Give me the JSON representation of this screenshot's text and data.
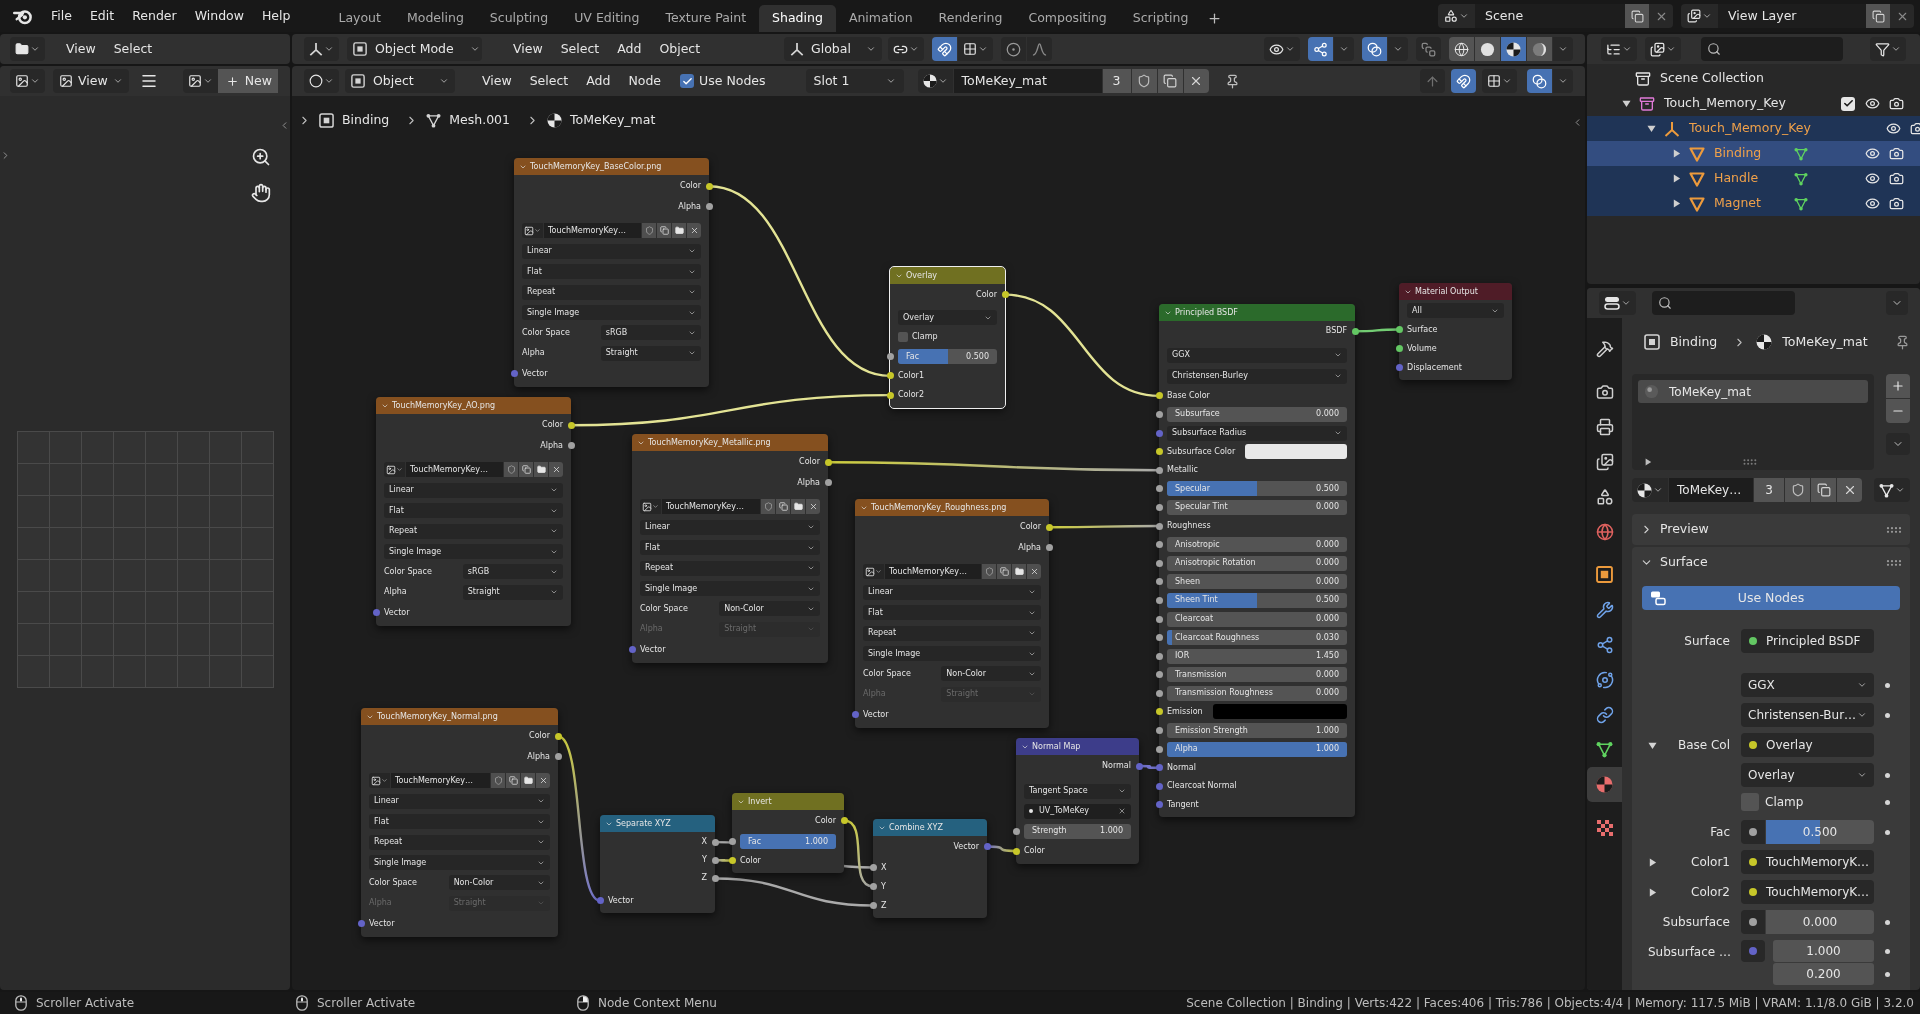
{
  "top_bar": {
    "menus": [
      "File",
      "Edit",
      "Render",
      "Window",
      "Help"
    ],
    "workspaces": [
      {
        "label": "Layout",
        "selected": false
      },
      {
        "label": "Modeling",
        "selected": false
      },
      {
        "label": "Sculpting",
        "selected": false
      },
      {
        "label": "UV Editing",
        "selected": false
      },
      {
        "label": "Texture Paint",
        "selected": false
      },
      {
        "label": "Shading",
        "selected": true
      },
      {
        "label": "Animation",
        "selected": false
      },
      {
        "label": "Rendering",
        "selected": false
      },
      {
        "label": "Compositing",
        "selected": false
      },
      {
        "label": "Scripting",
        "selected": false
      }
    ],
    "scene": "Scene",
    "view_layer": "View Layer"
  },
  "file_browser": {
    "menus": [
      "View",
      "Select"
    ]
  },
  "image_editor": {
    "view": "View",
    "new_button": "New"
  },
  "viewport_header": {
    "mode": "Object Mode",
    "menus": [
      "View",
      "Select",
      "Add",
      "Object"
    ],
    "orientation": "Global",
    "snap": true,
    "proportional_editing": false,
    "gizmos": true,
    "overlays": true,
    "xray": false,
    "shading": [
      {
        "kind": "wireframe",
        "selected": false
      },
      {
        "kind": "solid",
        "selected": false
      },
      {
        "kind": "material",
        "selected": true
      },
      {
        "kind": "rendered",
        "selected": false
      }
    ]
  },
  "node_header": {
    "type": "Object",
    "menus": [
      "View",
      "Select",
      "Add",
      "Node"
    ],
    "use_nodes": {
      "label": "Use Nodes",
      "checked": true
    },
    "slot": "Slot 1",
    "material": "ToMeKey_mat",
    "users": "3",
    "snap": true,
    "overlays": true
  },
  "breadcrumb": [
    {
      "kind": "object",
      "label": "Binding"
    },
    {
      "kind": "mesh",
      "label": "Mesh.001"
    },
    {
      "kind": "material",
      "label": "ToMeKey_mat"
    }
  ],
  "nodes": [
    {
      "title": "TouchMemoryKey_BaseColor.png",
      "color": "#85501f",
      "selected": false,
      "rows": [
        {
          "kind": "output",
          "label": "Color",
          "color": "#c7c729"
        },
        {
          "kind": "output",
          "label": "Alpha",
          "color": "#a1a1a1"
        },
        {
          "kind": "image",
          "value": "TouchMemoryKey…"
        },
        {
          "kind": "select",
          "value": "Linear"
        },
        {
          "kind": "select",
          "value": "Flat"
        },
        {
          "kind": "select",
          "value": "Repeat"
        },
        {
          "kind": "select",
          "value": "Single Image"
        },
        {
          "kind": "prop_select",
          "label": "Color Space",
          "value": "sRGB",
          "disabled": false
        },
        {
          "kind": "prop_select",
          "label": "Alpha",
          "value": "Straight",
          "disabled": false
        },
        {
          "kind": "input",
          "label": "Vector",
          "color": "#6363c7"
        }
      ]
    },
    {
      "title": "Overlay",
      "color": "#707021",
      "selected": true,
      "rows": [
        {
          "kind": "output",
          "label": "Color",
          "color": "#c7c729"
        },
        {
          "kind": "select",
          "value": "Overlay"
        },
        {
          "kind": "checkbox",
          "label": "Clamp",
          "checked": false
        },
        {
          "kind": "slider",
          "label": "Fac",
          "value": "0.500",
          "level": 0.5,
          "color": "#a1a1a1"
        },
        {
          "kind": "input",
          "label": "Color1",
          "color": "#c7c729"
        },
        {
          "kind": "input",
          "label": "Color2",
          "color": "#c7c729"
        }
      ]
    },
    {
      "title": "Material Output",
      "color": "#4f1c27",
      "selected": false,
      "rows": [
        {
          "kind": "select",
          "value": "All"
        },
        {
          "kind": "input",
          "label": "Surface",
          "color": "#63c763"
        },
        {
          "kind": "input",
          "label": "Volume",
          "color": "#63c763"
        },
        {
          "kind": "input",
          "label": "Displacement",
          "color": "#6363c7"
        }
      ]
    },
    {
      "title": "Principled BSDF",
      "color": "#2b6a2b",
      "selected": false,
      "rows": [
        {
          "kind": "output",
          "label": "BSDF",
          "color": "#63c763"
        },
        {
          "kind": "select",
          "value": "GGX"
        },
        {
          "kind": "select",
          "value": "Christensen-Burley"
        },
        {
          "kind": "input",
          "label": "Base Color",
          "color": "#c7c729"
        },
        {
          "kind": "slider",
          "label": "Subsurface",
          "value": "0.000",
          "level": 0,
          "color": "#a1a1a1"
        },
        {
          "kind": "socket_select",
          "label": "Subsurface Radius",
          "color": "#6363c7"
        },
        {
          "kind": "color",
          "label": "Subsurface Color",
          "color": "#c7c729",
          "swatch": {
            "color": "#e8e8e8"
          }
        },
        {
          "kind": "input",
          "label": "Metallic",
          "color": "#a1a1a1"
        },
        {
          "kind": "slider",
          "label": "Specular",
          "value": "0.500",
          "level": 0.5,
          "color": "#a1a1a1"
        },
        {
          "kind": "slider",
          "label": "Specular Tint",
          "value": "0.000",
          "level": 0,
          "color": "#a1a1a1"
        },
        {
          "kind": "input",
          "label": "Roughness",
          "color": "#a1a1a1"
        },
        {
          "kind": "slider",
          "label": "Anisotropic",
          "value": "0.000",
          "level": 0,
          "color": "#a1a1a1"
        },
        {
          "kind": "slider",
          "label": "Anisotropic Rotation",
          "value": "0.000",
          "level": 0,
          "color": "#a1a1a1"
        },
        {
          "kind": "slider",
          "label": "Sheen",
          "value": "0.000",
          "level": 0,
          "color": "#a1a1a1"
        },
        {
          "kind": "slider",
          "label": "Sheen Tint",
          "value": "0.500",
          "level": 0.5,
          "color": "#a1a1a1"
        },
        {
          "kind": "slider",
          "label": "Clearcoat",
          "value": "0.000",
          "level": 0,
          "color": "#a1a1a1"
        },
        {
          "kind": "slider",
          "label": "Clearcoat Roughness",
          "value": "0.030",
          "level": 0.03,
          "color": "#a1a1a1"
        },
        {
          "kind": "slider",
          "label": "IOR",
          "value": "1.450",
          "color": "#a1a1a1"
        },
        {
          "kind": "slider",
          "label": "Transmission",
          "value": "0.000",
          "level": 0,
          "color": "#a1a1a1"
        },
        {
          "kind": "slider",
          "label": "Transmission Roughness",
          "value": "0.000",
          "level": 0,
          "color": "#a1a1a1"
        },
        {
          "kind": "color",
          "label": "Emission",
          "color": "#c7c729",
          "swatch": {
            "color": "#000000"
          }
        },
        {
          "kind": "slider",
          "label": "Emission Strength",
          "value": "1.000",
          "color": "#a1a1a1"
        },
        {
          "kind": "slider",
          "label": "Alpha",
          "value": "1.000",
          "level": 1,
          "color": "#a1a1a1"
        },
        {
          "kind": "input",
          "label": "Normal",
          "color": "#6363c7"
        },
        {
          "kind": "input",
          "label": "Clearcoat Normal",
          "color": "#6363c7"
        },
        {
          "kind": "input",
          "label": "Tangent",
          "color": "#6363c7"
        }
      ]
    },
    {
      "title": "TouchMemoryKey_AO.png",
      "color": "#85501f",
      "selected": false,
      "rows": [
        {
          "kind": "output",
          "label": "Color",
          "color": "#c7c729"
        },
        {
          "kind": "output",
          "label": "Alpha",
          "color": "#a1a1a1"
        },
        {
          "kind": "image",
          "value": "TouchMemoryKey…"
        },
        {
          "kind": "select",
          "value": "Linear"
        },
        {
          "kind": "select",
          "value": "Flat"
        },
        {
          "kind": "select",
          "value": "Repeat"
        },
        {
          "kind": "select",
          "value": "Single Image"
        },
        {
          "kind": "prop_select",
          "label": "Color Space",
          "value": "sRGB",
          "disabled": false
        },
        {
          "kind": "prop_select",
          "label": "Alpha",
          "value": "Straight",
          "disabled": false
        },
        {
          "kind": "input",
          "label": "Vector",
          "color": "#6363c7"
        }
      ]
    },
    {
      "title": "TouchMemoryKey_Metallic.png",
      "color": "#85501f",
      "selected": false,
      "rows": [
        {
          "kind": "output",
          "label": "Color",
          "color": "#c7c729"
        },
        {
          "kind": "output",
          "label": "Alpha",
          "color": "#a1a1a1"
        },
        {
          "kind": "image",
          "value": "TouchMemoryKey…"
        },
        {
          "kind": "select",
          "value": "Linear"
        },
        {
          "kind": "select",
          "value": "Flat"
        },
        {
          "kind": "select",
          "value": "Repeat"
        },
        {
          "kind": "select",
          "value": "Single Image"
        },
        {
          "kind": "prop_select",
          "label": "Color Space",
          "value": "Non-Color",
          "disabled": false
        },
        {
          "kind": "prop_select",
          "label": "Alpha",
          "value": "Straight",
          "disabled": true
        },
        {
          "kind": "input",
          "label": "Vector",
          "color": "#6363c7"
        }
      ]
    },
    {
      "title": "TouchMemoryKey_Roughness.png",
      "color": "#85501f",
      "selected": false,
      "rows": [
        {
          "kind": "output",
          "label": "Color",
          "color": "#c7c729"
        },
        {
          "kind": "output",
          "label": "Alpha",
          "color": "#a1a1a1"
        },
        {
          "kind": "image",
          "value": "TouchMemoryKey…"
        },
        {
          "kind": "select",
          "value": "Linear"
        },
        {
          "kind": "select",
          "value": "Flat"
        },
        {
          "kind": "select",
          "value": "Repeat"
        },
        {
          "kind": "select",
          "value": "Single Image"
        },
        {
          "kind": "prop_select",
          "label": "Color Space",
          "value": "Non-Color",
          "disabled": false
        },
        {
          "kind": "prop_select",
          "label": "Alpha",
          "value": "Straight",
          "disabled": true
        },
        {
          "kind": "input",
          "label": "Vector",
          "color": "#6363c7"
        }
      ]
    },
    {
      "title": "TouchMemoryKey_Normal.png",
      "color": "#85501f",
      "selected": false,
      "rows": [
        {
          "kind": "output",
          "label": "Color",
          "color": "#c7c729"
        },
        {
          "kind": "output",
          "label": "Alpha",
          "color": "#a1a1a1"
        },
        {
          "kind": "image",
          "value": "TouchMemoryKey…"
        },
        {
          "kind": "select",
          "value": "Linear"
        },
        {
          "kind": "select",
          "value": "Flat"
        },
        {
          "kind": "select",
          "value": "Repeat"
        },
        {
          "kind": "select",
          "value": "Single Image"
        },
        {
          "kind": "prop_select",
          "label": "Color Space",
          "value": "Non-Color",
          "disabled": false
        },
        {
          "kind": "prop_select",
          "label": "Alpha",
          "value": "Straight",
          "disabled": true
        },
        {
          "kind": "input",
          "label": "Vector",
          "color": "#6363c7"
        }
      ]
    },
    {
      "title": "Normal Map",
      "color": "#3d3d8a",
      "selected": false,
      "rows": [
        {
          "kind": "output",
          "label": "Normal",
          "color": "#6363c7"
        },
        {
          "kind": "select",
          "value": "Tangent Space"
        },
        {
          "kind": "uv_field",
          "value": "UV_ToMeKey"
        },
        {
          "kind": "slider",
          "label": "Strength",
          "value": "1.000",
          "color": "#a1a1a1"
        },
        {
          "kind": "input",
          "label": "Color",
          "color": "#c7c729"
        }
      ]
    },
    {
      "title": "Invert",
      "color": "#707021",
      "selected": false,
      "rows": [
        {
          "kind": "output",
          "label": "Color",
          "color": "#c7c729"
        },
        {
          "kind": "slider",
          "label": "Fac",
          "value": "1.000",
          "level": 1,
          "color": "#a1a1a1"
        },
        {
          "kind": "input",
          "label": "Color",
          "color": "#c7c729"
        }
      ]
    },
    {
      "title": "Separate XYZ",
      "color": "#25617f",
      "selected": false,
      "rows": [
        {
          "kind": "output",
          "label": "X",
          "color": "#a1a1a1"
        },
        {
          "kind": "output",
          "label": "Y",
          "color": "#a1a1a1"
        },
        {
          "kind": "output",
          "label": "Z",
          "color": "#a1a1a1"
        },
        {
          "kind": "input",
          "label": "Vector",
          "color": "#6363c7"
        }
      ]
    },
    {
      "title": "Combine XYZ",
      "color": "#25617f",
      "selected": false,
      "rows": [
        {
          "kind": "output",
          "label": "Vector",
          "color": "#6363c7"
        },
        {
          "kind": "input",
          "label": "X",
          "color": "#a1a1a1"
        },
        {
          "kind": "input",
          "label": "Y",
          "color": "#a1a1a1"
        },
        {
          "kind": "input",
          "label": "Z",
          "color": "#a1a1a1"
        }
      ]
    }
  ],
  "outliner": {
    "items": [
      {
        "kind": "scene_collection",
        "label": "Scene Collection",
        "selected": false,
        "active": false,
        "children": [
          {
            "kind": "collection",
            "label": "Touch_Memory_Key",
            "expanded": true,
            "checked": true,
            "selected": false,
            "active": false,
            "children": [
              {
                "kind": "empty",
                "label": "Touch_Memory_Key",
                "expanded": true,
                "selected": true,
                "active": false,
                "children": [
                  {
                    "kind": "mesh",
                    "label": "Binding",
                    "expanded": false,
                    "selected": true,
                    "active": true
                  },
                  {
                    "kind": "mesh",
                    "label": "Handle",
                    "expanded": false,
                    "selected": true,
                    "active": false
                  },
                  {
                    "kind": "mesh",
                    "label": "Magnet",
                    "expanded": false,
                    "selected": true,
                    "active": false
                  }
                ]
              }
            ]
          }
        ]
      }
    ]
  },
  "properties": {
    "tabs": [
      {
        "kind": "tool",
        "selected": false
      },
      {
        "kind": "render",
        "selected": false
      },
      {
        "kind": "output",
        "selected": false
      },
      {
        "kind": "view_layer",
        "selected": false
      },
      {
        "kind": "scene",
        "selected": false
      },
      {
        "kind": "world",
        "selected": false
      },
      {
        "kind": "object",
        "selected": false
      },
      {
        "kind": "modifiers",
        "selected": false
      },
      {
        "kind": "particles",
        "selected": false
      },
      {
        "kind": "physics",
        "selected": false
      },
      {
        "kind": "constraints",
        "selected": false
      },
      {
        "kind": "data",
        "selected": false
      },
      {
        "kind": "material",
        "selected": true
      },
      {
        "kind": "texture",
        "selected": false
      }
    ],
    "breadcrumb": [
      "Binding",
      "ToMeKey_mat"
    ],
    "slots": [
      {
        "label": "ToMeKey_mat",
        "selected": true
      }
    ],
    "material": {
      "name": "ToMeKey…",
      "users": "3"
    },
    "panels": [
      {
        "label": "Preview",
        "expanded": false
      },
      {
        "label": "Surface",
        "expanded": true,
        "button": "Use Nodes",
        "fields": [
          {
            "kind": "link",
            "label": "Surface",
            "value": "Principled BSDF",
            "color": "#63c763"
          },
          {
            "kind": "select",
            "value": "GGX"
          },
          {
            "kind": "select",
            "value": "Christensen-Bur…"
          },
          {
            "kind": "link",
            "label": "Base Col",
            "value": "Overlay",
            "color": "#c7c729",
            "expanded": true
          },
          {
            "kind": "select",
            "value": "Overlay"
          },
          {
            "kind": "checkbox",
            "label": "Clamp",
            "checked": false
          },
          {
            "kind": "slider",
            "label": "Fac",
            "value": "0.500",
            "level": 0.5,
            "color": "#a1a1a1"
          },
          {
            "kind": "link",
            "label": "Color1",
            "value": "TouchMemoryK…",
            "color": "#c7c729",
            "expanded": false
          },
          {
            "kind": "link",
            "label": "Color2",
            "value": "TouchMemoryK…",
            "color": "#c7c729",
            "expanded": false
          },
          {
            "kind": "number",
            "label": "Subsurface",
            "value": "0.000",
            "color": "#a1a1a1"
          },
          {
            "kind": "vector",
            "label": "Subsurface …",
            "values": [
              "1.000",
              "0.200"
            ],
            "color": "#6363c7"
          }
        ]
      }
    ]
  },
  "status_bar": {
    "hints": [
      {
        "kind": "scroll",
        "label": "Scroller Activate"
      },
      {
        "kind": "scroll",
        "label": "Scroller Activate"
      },
      {
        "kind": "right_click",
        "label": "Node Context Menu"
      }
    ],
    "stats": "Scene Collection | Binding | Verts:422 | Faces:406 | Tris:786 | Objects:4/4 | Memory: 117.5 MiB | VRAM: 1.1/8.0 GiB | 3.2.0"
  }
}
